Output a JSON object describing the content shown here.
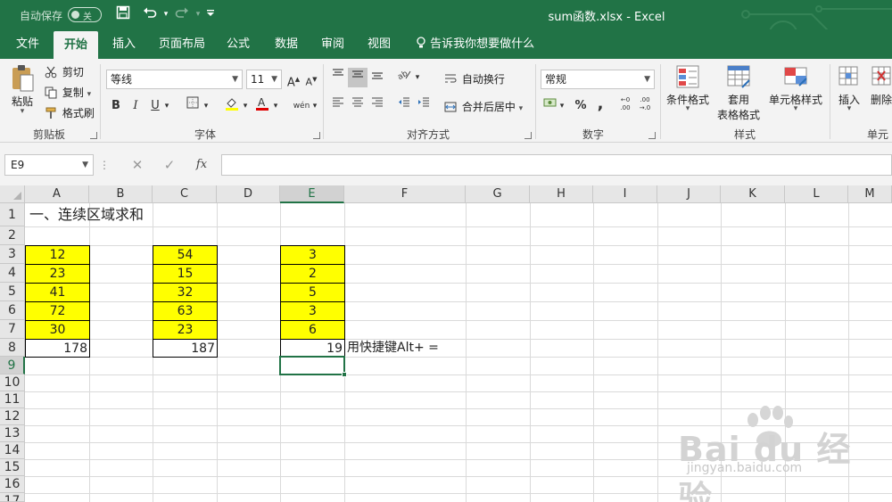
{
  "titlebar": {
    "autosave_label": "自动保存",
    "autosave_state": "关",
    "doc_title": "sum函数.xlsx  -  Excel",
    "accent": "#217346"
  },
  "tabs": [
    "文件",
    "开始",
    "插入",
    "页面布局",
    "公式",
    "数据",
    "审阅",
    "视图"
  ],
  "active_tab": "开始",
  "tell_me": "告诉我你想要做什么",
  "ribbon": {
    "clipboard": {
      "paste": "粘贴",
      "cut": "剪切",
      "copy": "复制",
      "format_painter": "格式刷",
      "label": "剪贴板"
    },
    "font": {
      "name": "等线",
      "size": "11",
      "label": "字体"
    },
    "alignment": {
      "wrap": "自动换行",
      "merge": "合并后居中",
      "label": "对齐方式"
    },
    "number": {
      "format": "常规",
      "label": "数字"
    },
    "styles": {
      "conditional": "条件格式",
      "table_1": "套用",
      "table_2": "表格格式",
      "cell_styles": "单元格样式",
      "label": "样式"
    },
    "cells": {
      "insert": "插入",
      "delete": "删除",
      "label": "单元"
    }
  },
  "formula_bar": {
    "name_box": "E9",
    "fx": "fx",
    "formula": ""
  },
  "columns": [
    "A",
    "B",
    "C",
    "D",
    "E",
    "F",
    "G",
    "H",
    "I",
    "J",
    "K",
    "L",
    "M"
  ],
  "selected_column": "E",
  "rows": [
    "1",
    "2",
    "3",
    "4",
    "5",
    "6",
    "7",
    "8",
    "9",
    "10",
    "11",
    "12",
    "13",
    "14",
    "15",
    "16",
    "17"
  ],
  "selected_row": "9",
  "cells": {
    "A1": "一、连续区域求和",
    "A3": "12",
    "A4": "23",
    "A5": "41",
    "A6": "72",
    "A7": "30",
    "A8": "178",
    "C3": "54",
    "C4": "15",
    "C5": "32",
    "C6": "63",
    "C7": "23",
    "C8": "187",
    "E3": "3",
    "E4": "2",
    "E5": "5",
    "E6": "3",
    "E7": "6",
    "E8": "19",
    "F8": "用快捷键Alt+ ="
  },
  "highlight_color": "#ffff00",
  "watermark": {
    "logo": "Bai du 经验",
    "url": "jingyan.baidu.com"
  }
}
